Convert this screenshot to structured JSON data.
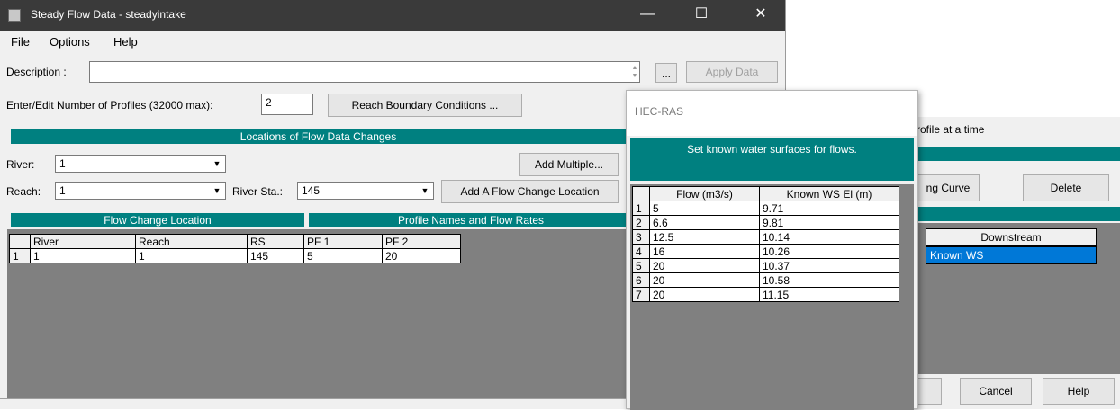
{
  "window": {
    "title": "Steady Flow Data - steadyintake",
    "minimize": "—",
    "maximize": "☐",
    "close": "✕"
  },
  "menu": [
    "File",
    "Options",
    "Help"
  ],
  "description": {
    "label": "Description :",
    "value": "",
    "browse": "...",
    "apply": "Apply Data"
  },
  "profiles": {
    "label": "Enter/Edit Number of Profiles (32000 max):",
    "value": "2",
    "reach_bc": "Reach Boundary Conditions ..."
  },
  "locations": {
    "header": "Locations of Flow Data Changes",
    "river_label": "River:",
    "river_value": "1",
    "reach_label": "Reach:",
    "reach_value": "1",
    "station_label": "River Sta.:",
    "station_value": "145",
    "add_multiple": "Add Multiple...",
    "add_location": "Add A Flow Change Location"
  },
  "flow_change": {
    "header": "Flow Change Location",
    "profile_header": "Profile Names and Flow Rates",
    "columns": [
      "River",
      "Reach",
      "RS",
      "PF 1",
      "PF 2"
    ],
    "rows": [
      {
        "num": "1",
        "river": "1",
        "reach": "1",
        "rs": "145",
        "pf1": "5",
        "pf2": "20"
      }
    ]
  },
  "background_right": {
    "profile_text": "rofile at a time",
    "rating_curve": "ng Curve",
    "delete": "Delete",
    "downstream_header": "Downstream",
    "downstream_value": "Known WS",
    "cancel": "Cancel",
    "help": "Help"
  },
  "dialog": {
    "title": "HEC-RAS",
    "banner": "Set known water surfaces for flows.",
    "columns": [
      "Flow (m3/s)",
      "Known WS El (m)"
    ],
    "rows": [
      {
        "num": "1",
        "flow": "5",
        "ws": "9.71"
      },
      {
        "num": "2",
        "flow": "6.6",
        "ws": "9.81"
      },
      {
        "num": "3",
        "flow": "12.5",
        "ws": "10.14"
      },
      {
        "num": "4",
        "flow": "16",
        "ws": "10.26"
      },
      {
        "num": "5",
        "flow": "20",
        "ws": "10.37"
      },
      {
        "num": "6",
        "flow": "20",
        "ws": "10.58"
      },
      {
        "num": "7",
        "flow": "20",
        "ws": "11.15"
      }
    ]
  },
  "colors": {
    "teal": "#008080",
    "titlebar": "#3a3a3a",
    "grid_bg": "#808080",
    "selected": "#0078d7"
  }
}
